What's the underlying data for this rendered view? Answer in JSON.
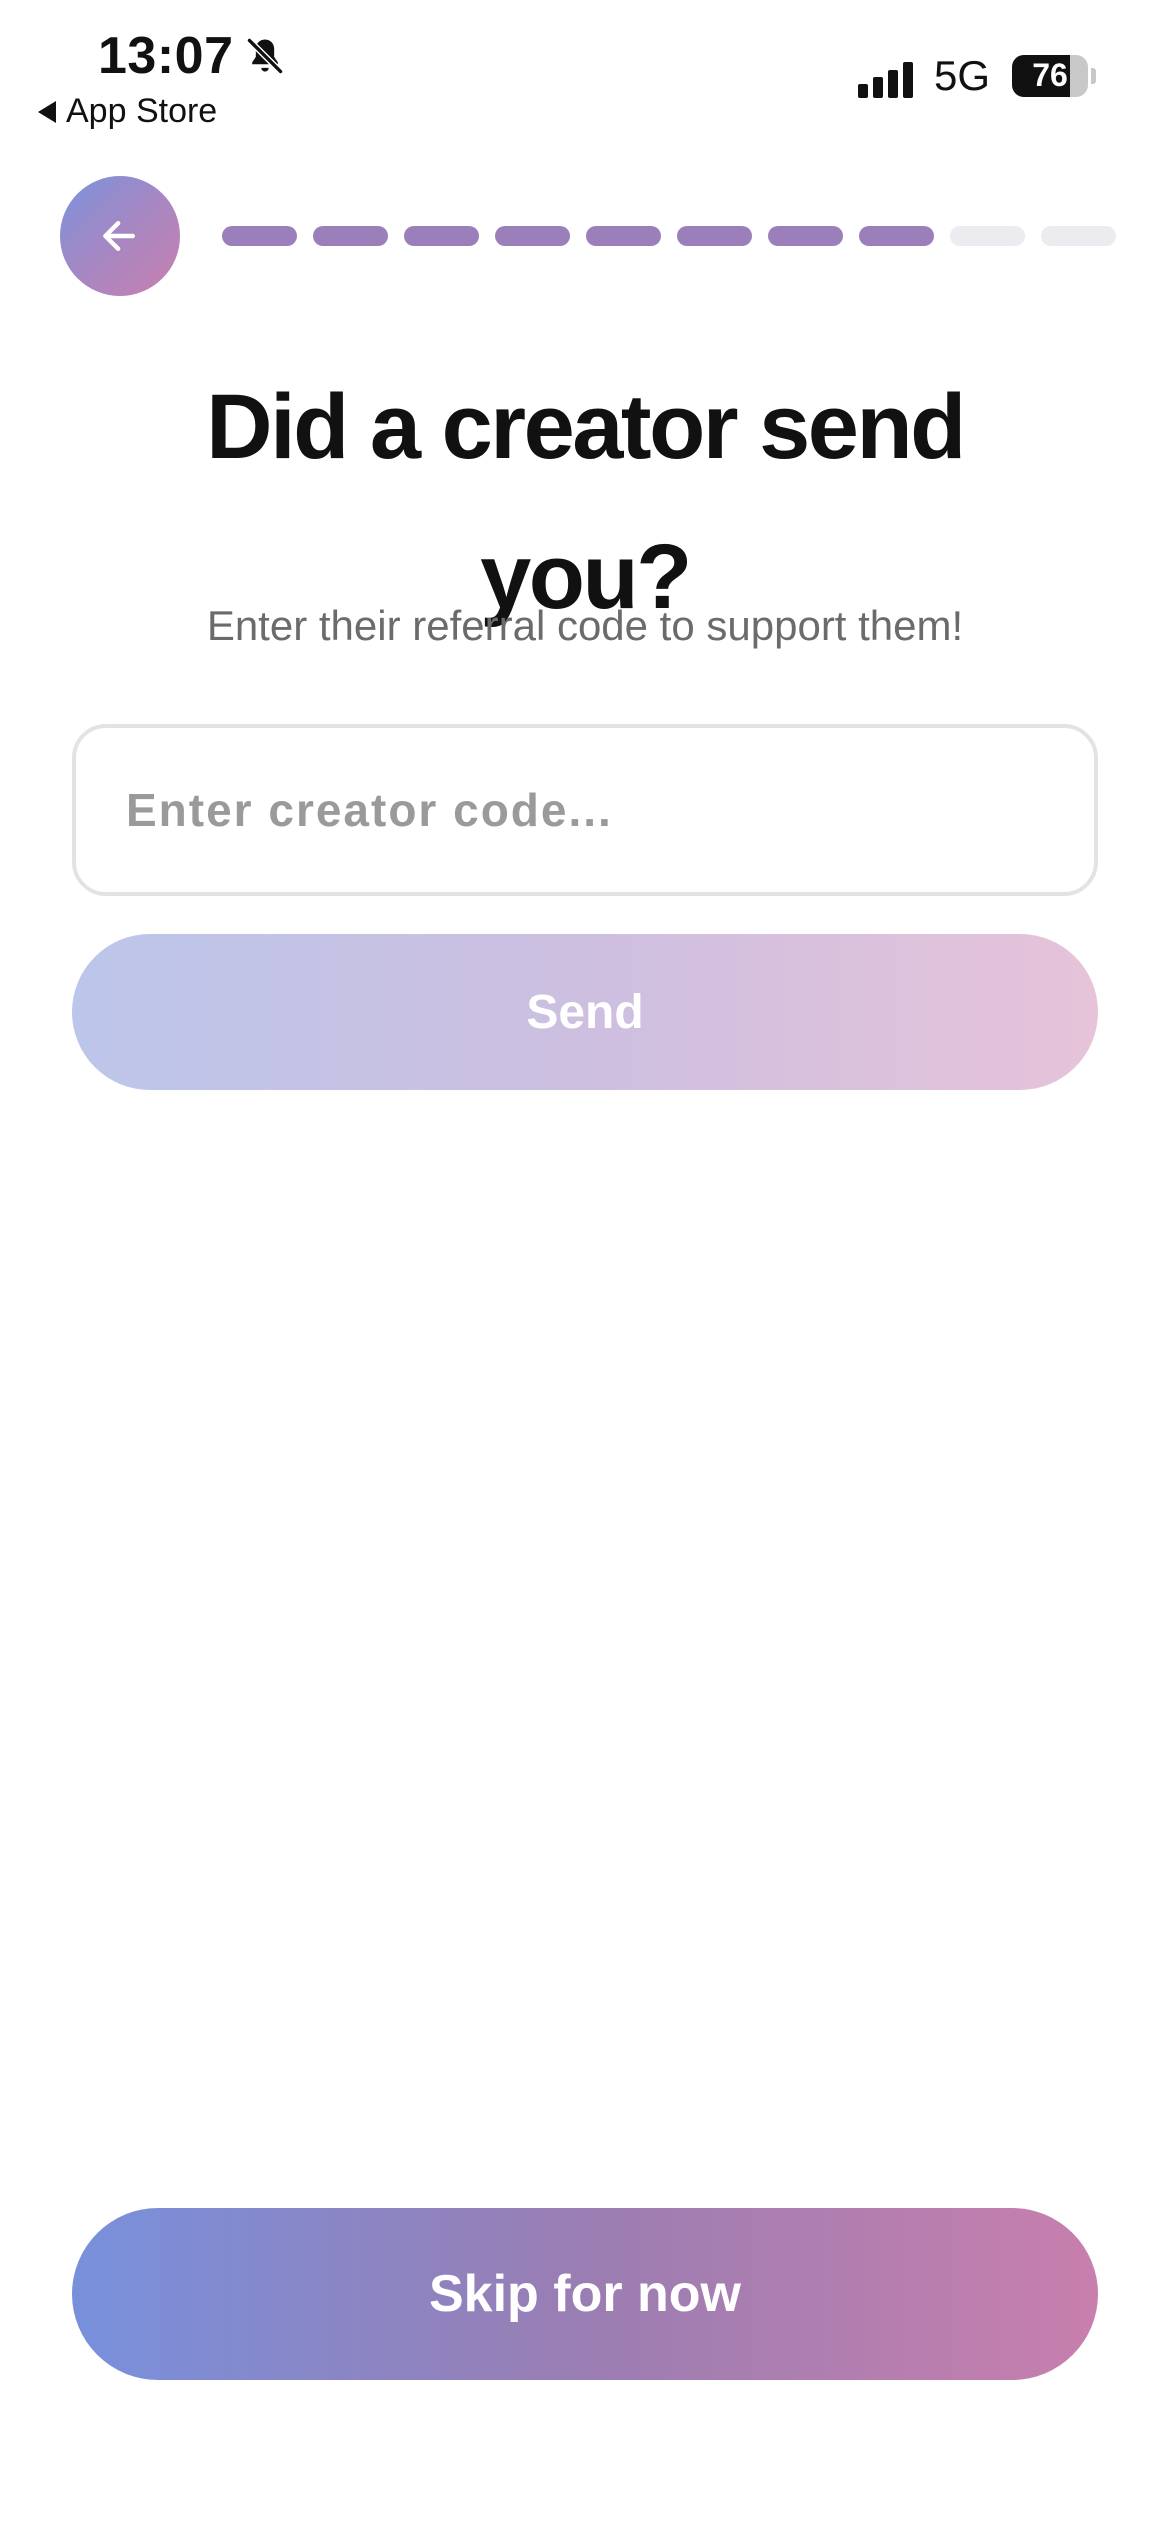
{
  "status_bar": {
    "time": "13:07",
    "back_label": "App Store",
    "network": "5G",
    "battery": "76",
    "bell_icon": "bell-slash-icon",
    "signal_icon": "cellular-signal-icon"
  },
  "nav": {
    "back_icon": "arrow-left-icon",
    "progress": {
      "completed_steps": 8,
      "total_steps": 10
    }
  },
  "main": {
    "title": "Did a creator send you?",
    "subtitle": "Enter their referral code to support them!",
    "code_input": {
      "placeholder": "Enter creator code...",
      "value": ""
    },
    "send_label": "Send"
  },
  "footer": {
    "skip_label": "Skip for now"
  },
  "colors": {
    "accent_start": "#7890dc",
    "accent_end": "#c87fad",
    "progress_done": "#9b7fbb",
    "progress_todo": "#ececf0"
  }
}
